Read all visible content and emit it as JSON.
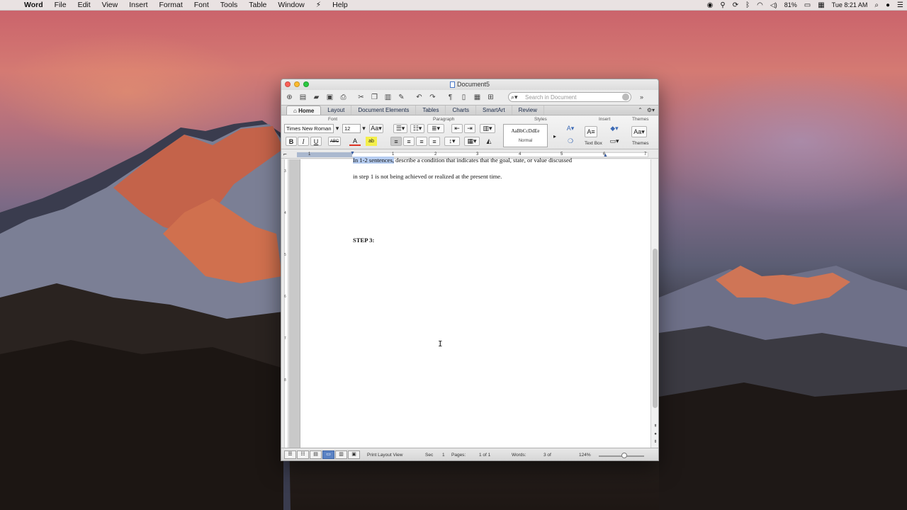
{
  "menubar": {
    "app": "Word",
    "items": [
      "File",
      "Edit",
      "View",
      "Insert",
      "Format",
      "Font",
      "Tools",
      "Table",
      "Window",
      "Help"
    ],
    "battery": "81%",
    "clock": "Tue 8:21 AM"
  },
  "window": {
    "title": "Document5",
    "search_placeholder": "Search in Document",
    "tabs": [
      "Home",
      "Layout",
      "Document Elements",
      "Tables",
      "Charts",
      "SmartArt",
      "Review"
    ],
    "ribbon": {
      "group_font": "Font",
      "group_paragraph": "Paragraph",
      "group_styles": "Styles",
      "group_insert": "Insert",
      "group_themes": "Themes",
      "font_name": "Times New Roman",
      "font_size": "12",
      "style_sample": "AaBbCcDdEe",
      "style_name": "Normal",
      "text_box_label": "Text Box",
      "themes_label": "Themes"
    },
    "ruler_numbers": [
      "1",
      "1",
      "2",
      "3",
      "4",
      "5",
      "6",
      "7"
    ],
    "vruler_numbers": [
      "3",
      "4",
      "5",
      "6",
      "7",
      "8"
    ],
    "document": {
      "cut_line_highlight": "In 1-2 sentences,",
      "cut_line_rest": " describe a condition that indicates that the goal, state, or value discussed",
      "line2": "in step 1 is not being achieved or realized at the present time.",
      "step3": "STEP 3:"
    },
    "status": {
      "view": "Print Layout View",
      "sec_label": "Sec",
      "sec_value": "1",
      "pages_label": "Pages:",
      "pages_value": "1 of 1",
      "words_label": "Words:",
      "words_value": "3 of",
      "zoom": "124%"
    }
  },
  "colors": {
    "accent": "#5a82c4",
    "highlight": "#b6cdf1",
    "close": "#fc5f57",
    "minimize": "#fdbb2e",
    "maximize": "#2ac940"
  }
}
